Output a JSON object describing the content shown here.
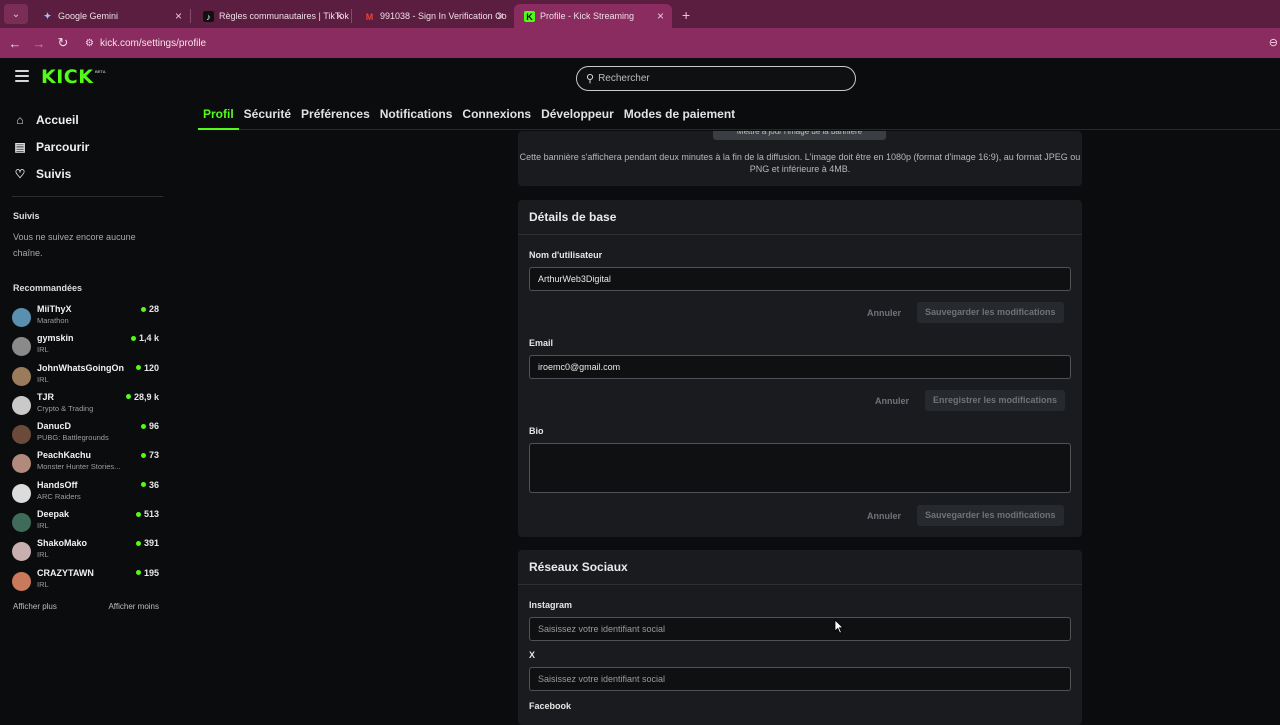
{
  "browser": {
    "tabs": [
      {
        "title": "Google Gemini",
        "favicon": "gemini-icon",
        "active": false
      },
      {
        "title": "Règles communautaires | TikTok",
        "favicon": "tiktok-icon",
        "active": false
      },
      {
        "title": "991038 - Sign In Verification Co",
        "favicon": "gmail-icon",
        "active": false
      },
      {
        "title": "Profile - Kick Streaming",
        "favicon": "kick-icon",
        "active": true
      }
    ],
    "url": "kick.com/settings/profile"
  },
  "header": {
    "logo": "KICK",
    "logo_badge": "BETA",
    "search_placeholder": "Rechercher"
  },
  "sidebar": {
    "nav": [
      {
        "label": "Accueil",
        "icon": "home-icon"
      },
      {
        "label": "Parcourir",
        "icon": "browse-icon"
      },
      {
        "label": "Suivis",
        "icon": "heart-icon"
      }
    ],
    "following_heading": "Suivis",
    "following_empty": "Vous ne suivez encore aucune chaîne.",
    "recommended_heading": "Recommandées",
    "recommended": [
      {
        "name": "MiiThyX",
        "category": "Marathon",
        "viewers": "28",
        "color": "#5b8fb0"
      },
      {
        "name": "gymskin",
        "category": "IRL",
        "viewers": "1,4 k",
        "color": "#8a8a8a"
      },
      {
        "name": "JohnWhatsGoingOn",
        "category": "IRL",
        "viewers": "120",
        "color": "#9a7b5b"
      },
      {
        "name": "TJR",
        "category": "Crypto & Trading",
        "viewers": "28,9 k",
        "color": "#c9c9c9"
      },
      {
        "name": "DanucD",
        "category": "PUBG: Battlegrounds",
        "viewers": "96",
        "color": "#6b4a3a"
      },
      {
        "name": "PeachKachu",
        "category": "Monster Hunter Stories...",
        "viewers": "73",
        "color": "#b08a7a"
      },
      {
        "name": "HandsOff",
        "category": "ARC Raiders",
        "viewers": "36",
        "color": "#dcdcdc"
      },
      {
        "name": "Deepak",
        "category": "IRL",
        "viewers": "513",
        "color": "#3f6b5a"
      },
      {
        "name": "ShakoMako",
        "category": "IRL",
        "viewers": "391",
        "color": "#c8b0b0"
      },
      {
        "name": "CRAZYTAWN",
        "category": "IRL",
        "viewers": "195",
        "color": "#c97a5a"
      }
    ],
    "show_more": "Afficher plus",
    "show_less": "Afficher moins"
  },
  "settings_tabs": [
    {
      "label": "Profil",
      "active": true
    },
    {
      "label": "Sécurité",
      "active": false
    },
    {
      "label": "Préférences",
      "active": false
    },
    {
      "label": "Notifications",
      "active": false
    },
    {
      "label": "Connexions",
      "active": false
    },
    {
      "label": "Développeur",
      "active": false
    },
    {
      "label": "Modes de paiement",
      "active": false
    }
  ],
  "banner": {
    "button": "Mettre à jour l'image de la bannière",
    "note": "Cette bannière s'affichera pendant deux minutes à la fin de la diffusion. L'image doit être en 1080p (format d'image 16:9), au format JPEG ou PNG et inférieure à 4MB."
  },
  "basic_details": {
    "title": "Détails de base",
    "username_label": "Nom d'utilisateur",
    "username_value": "ArthurWeb3Digital",
    "cancel": "Annuler",
    "save_username": "Sauvegarder les modifications",
    "email_label": "Email",
    "email_value": "iroemc0@gmail.com",
    "save_email": "Enregistrer les modifications",
    "bio_label": "Bio",
    "save_bio": "Sauvegarder les modifications"
  },
  "socials": {
    "title": "Réseaux Sociaux",
    "instagram_label": "Instagram",
    "x_label": "X",
    "facebook_label": "Facebook",
    "placeholder": "Saisissez votre identifiant social"
  },
  "colors": {
    "accent": "#53fc18",
    "chrome": "#8a2c5f"
  }
}
